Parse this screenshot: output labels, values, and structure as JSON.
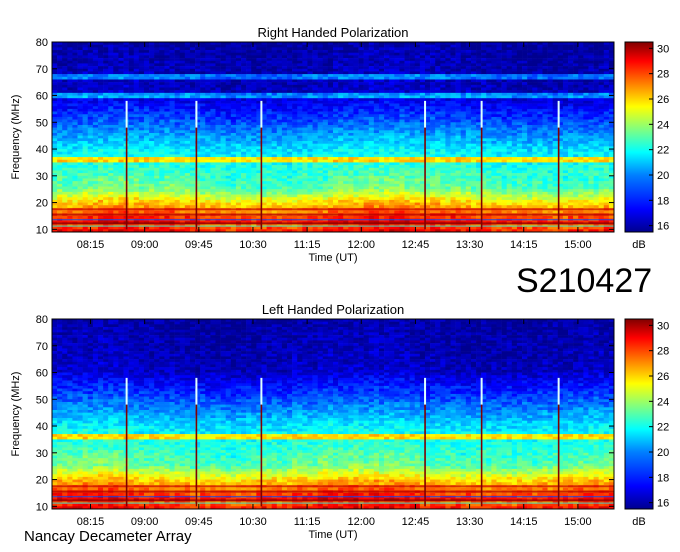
{
  "observation_id": "S210427",
  "instrument": "Nancay Decameter Array",
  "colors": {
    "background": "#ffffff",
    "colormap": [
      "#00008f",
      "#0000ff",
      "#0080ff",
      "#00ffff",
      "#80ff80",
      "#ffff00",
      "#ff8000",
      "#ff0000",
      "#800000"
    ]
  },
  "chart_data": [
    {
      "type": "heatmap",
      "title": "Right Handed Polarization",
      "xlabel": "Time (UT)",
      "ylabel": "Frequency (MHz)",
      "colorbar_label": "dB",
      "x_ticks": [
        "08:15",
        "09:00",
        "09:45",
        "10:30",
        "11:15",
        "12:00",
        "12:45",
        "13:30",
        "14:15",
        "15:00"
      ],
      "x_tick_minutes": [
        495,
        540,
        585,
        630,
        675,
        720,
        765,
        810,
        855,
        900
      ],
      "xlim_minutes": [
        463,
        930
      ],
      "y_ticks": [
        10,
        20,
        30,
        40,
        50,
        60,
        70,
        80
      ],
      "ylim": [
        9,
        80
      ],
      "colorbar_ticks": [
        16,
        18,
        20,
        22,
        24,
        26,
        28,
        30
      ],
      "clim": [
        15.5,
        30.5
      ],
      "bursts_minutes": [
        525,
        583,
        637,
        773,
        820,
        884
      ],
      "interference_lines_mhz": [
        67,
        60,
        36
      ]
    },
    {
      "type": "heatmap",
      "title": "Left Handed Polarization",
      "xlabel": "Time (UT)",
      "ylabel": "Frequency (MHz)",
      "colorbar_label": "dB",
      "x_ticks": [
        "08:15",
        "09:00",
        "09:45",
        "10:30",
        "11:15",
        "12:00",
        "12:45",
        "13:30",
        "14:15",
        "15:00"
      ],
      "x_tick_minutes": [
        495,
        540,
        585,
        630,
        675,
        720,
        765,
        810,
        855,
        900
      ],
      "xlim_minutes": [
        463,
        930
      ],
      "y_ticks": [
        10,
        20,
        30,
        40,
        50,
        60,
        70,
        80
      ],
      "ylim": [
        9,
        80
      ],
      "colorbar_ticks": [
        16,
        18,
        20,
        22,
        24,
        26,
        28,
        30
      ],
      "clim": [
        15.5,
        30.5
      ],
      "bursts_minutes": [
        525,
        583,
        637,
        773,
        820,
        884
      ],
      "interference_lines_mhz": [
        36
      ]
    }
  ]
}
